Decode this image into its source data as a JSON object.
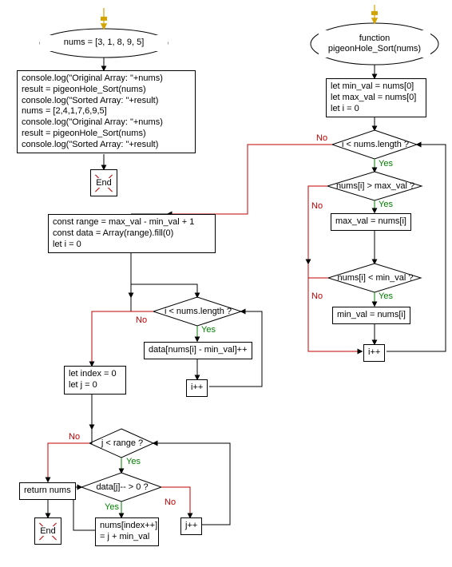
{
  "left": {
    "entry_node": "nums = [3, 1, 8, 9, 5]",
    "code_block": "console.log(\"Original Array: \"+nums)\nresult = pigeonHole_Sort(nums)\nconsole.log(\"Sorted Array: \"+result)\nnums = [2,4,1,7,6,9,5]\nconsole.log(\"Original Array: \"+nums)\nresult = pigeonHole_Sort(nums)\nconsole.log(\"Sorted Array: \"+result)",
    "end_label": "End"
  },
  "right": {
    "func_header": "function\npigeonHole_Sort(nums)",
    "init_block": "let min_val = nums[0]\nlet max_val = nums[0]\nlet i = 0",
    "cond_len1": "i < nums.length ?",
    "cond_max": "nums[i] > max_val ?",
    "set_max": "max_val = nums[i]",
    "cond_min": "nums[i] < min_val ?",
    "set_min": "min_val = nums[i]",
    "inc_i1": "i++",
    "mid_block": "const range = max_val - min_val + 1\nconst data = Array(range).fill(0)\nlet i = 0",
    "cond_len2": "i < nums.length ?",
    "fill_data": "data[nums[i] - min_val]++",
    "inc_i2": "i++",
    "init_j": "let index = 0\nlet j = 0",
    "cond_range": "j < range ?",
    "cond_data": "data[j]-- > 0 ?",
    "assign_nums": "nums[index++]\n= j + min_val",
    "inc_j": "j++",
    "return_nums": "return nums",
    "end_label": "End"
  },
  "labels": {
    "yes": "Yes",
    "no": "No"
  }
}
